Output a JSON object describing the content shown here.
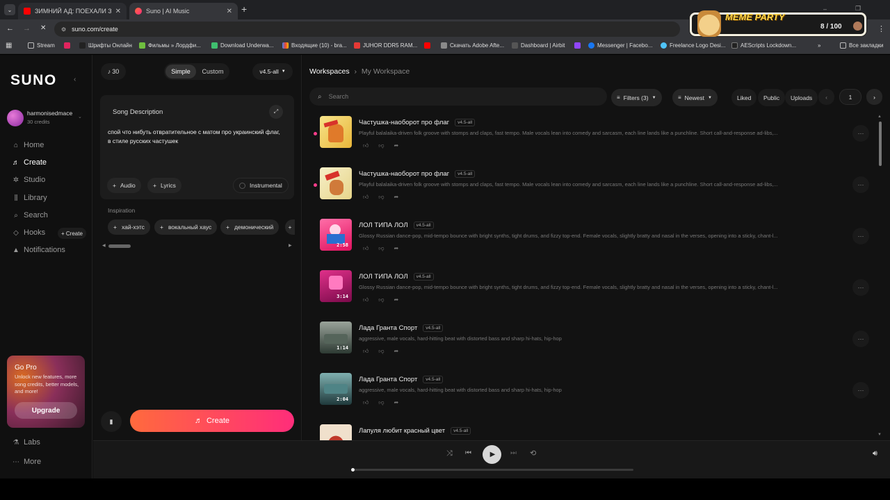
{
  "browser": {
    "tabs": [
      {
        "title": "ЗИМНИЙ АД: ПОЕХАЛИ ЗА Д",
        "close": "✕"
      },
      {
        "title": "Suno | AI Music",
        "close": "✕"
      }
    ],
    "new_tab": "+",
    "url": "suno.com/create",
    "bookmarks": [
      "Stream",
      "Шрифты Онлайн",
      "Фильмы » Лордфи...",
      "Download Underwa...",
      "Входящие (10) - bra...",
      "JUHOR DDR5 RAM...",
      "Скачать Adobe Afte...",
      "Dashboard | Airbit",
      "Messenger | Facebo...",
      "Freelance Logo Desi...",
      "AEScripts Lockdown..."
    ],
    "bookmarks_more": "»",
    "all_bookmarks": "Все закладки",
    "extension": {
      "name": "MEME PARTY",
      "score": "8 / 100"
    }
  },
  "sidebar": {
    "logo": "SUNO",
    "user": {
      "name": "harmonisedmace",
      "credits": "30 credits"
    },
    "nav": [
      {
        "label": "Home",
        "icon": "home-icon",
        "glyph": "⌂"
      },
      {
        "label": "Create",
        "icon": "music-note-icon",
        "glyph": "♬"
      },
      {
        "label": "Studio",
        "icon": "studio-icon",
        "glyph": "✲"
      },
      {
        "label": "Library",
        "icon": "library-icon",
        "glyph": "⫼"
      },
      {
        "label": "Search",
        "icon": "search-icon",
        "glyph": "⌕"
      },
      {
        "label": "Hooks",
        "icon": "hooks-icon",
        "glyph": "◇"
      },
      {
        "label": "Notifications",
        "icon": "bell-icon",
        "glyph": "▲"
      }
    ],
    "hooks_create": "+ Create",
    "promo": {
      "title": "Go Pro",
      "text": "Unlock new features, more song credits, better models, and more!",
      "button": "Upgrade"
    },
    "labs": "Labs",
    "more": "More"
  },
  "create": {
    "credits": "30",
    "modes": [
      "Simple",
      "Custom"
    ],
    "model": "v4.5-all",
    "song_description_label": "Song Description",
    "song_description": "спой что нибуть отвратительное с матом про украинский флаг, в стиле русских частушек",
    "options": [
      "Audio",
      "Lyrics"
    ],
    "instrumental": "Instrumental",
    "inspiration_label": "Inspiration",
    "inspiration": [
      "хай-хэтс",
      "вокальный хаус",
      "демонический"
    ],
    "create_button": "Create"
  },
  "workspace": {
    "breadcrumb": [
      "Workspaces",
      "My Workspace"
    ],
    "breadcrumb_sep": "›",
    "search_placeholder": "Search",
    "filters": "Filters (3)",
    "sort": "Newest",
    "toggles": [
      "Liked",
      "Public",
      "Uploads"
    ],
    "page": "1",
    "songs": [
      {
        "title": "Частушка-наоборот про флаг",
        "version": "v4.5-all",
        "description": "Playful balalaika-driven folk groove with stomps and claps, fast tempo. Male vocals lean into comedy and sarcasm, each line lands like a punchline. Short call-and-response ad-libs,...",
        "duration": "",
        "thumb": "#f0d060"
      },
      {
        "title": "Частушка-наоборот про флаг",
        "version": "v4.5-all",
        "description": "Playful balalaika-driven folk groove with stomps and claps, fast tempo. Male vocals lean into comedy and sarcasm, each line lands like a punchline. Short call-and-response ad-libs,...",
        "duration": "",
        "thumb": "#f3e0a0"
      },
      {
        "title": "ЛОЛ ТИПА ЛОЛ",
        "version": "v4.5-all",
        "description": "Glossy Russian dance-pop, mid-tempo bounce with bright synths, tight drums, and fizzy top-end. Female vocals, slightly bratty and nasal in the verses, opening into a sticky, chant-l...",
        "duration": "2:58",
        "thumb": "#ff2d7a"
      },
      {
        "title": "ЛОЛ ТИПА ЛОЛ",
        "version": "v4.5-all",
        "description": "Glossy Russian dance-pop, mid-tempo bounce with bright synths, tight drums, and fizzy top-end. Female vocals, slightly bratty and nasal in the verses, opening into a sticky, chant-l...",
        "duration": "3:14",
        "thumb": "#d0207a"
      },
      {
        "title": "Лада Гранта Спорт",
        "version": "v4.5-all",
        "description": "aggressive, male vocals, hard-hitting beat with distorted bass and sharp hi-hats, hip-hop",
        "duration": "1:14",
        "thumb": "#4d5a50"
      },
      {
        "title": "Лада Гранта Спорт",
        "version": "v4.5-all",
        "description": "aggressive, male vocals, hard-hitting beat with distorted bass and sharp hi-hats, hip-hop",
        "duration": "2:04",
        "thumb": "#3f6a6a"
      },
      {
        "title": "Лапуля любит красный цвет",
        "version": "v4.5-all",
        "description": "",
        "duration": "",
        "thumb": "#e8d6c0"
      }
    ]
  },
  "player": {
    "progress": 0.0
  },
  "colors": {
    "accent_pink": "#ff3d8b",
    "create_start": "#ff6a3d",
    "create_end": "#ff2d7a",
    "background": "#101010"
  }
}
